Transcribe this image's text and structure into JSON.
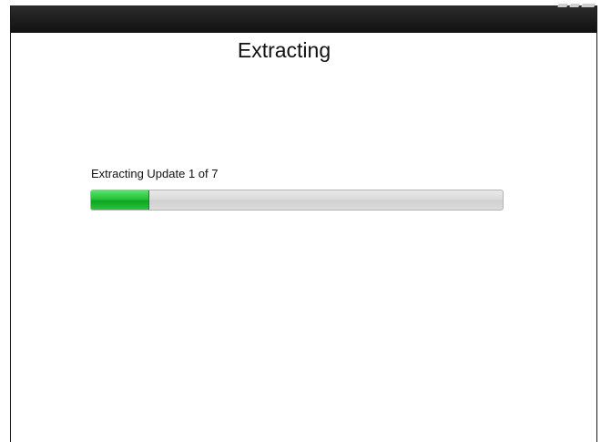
{
  "header": {
    "title": "Extracting"
  },
  "status": {
    "text": "Extracting Update 1 of 7",
    "progress_fraction": 0.14
  },
  "colors": {
    "progress_fill": "#22bb36",
    "topbar": "#1c1c1c"
  },
  "icons": {
    "brand": "brand-logo-icon"
  }
}
